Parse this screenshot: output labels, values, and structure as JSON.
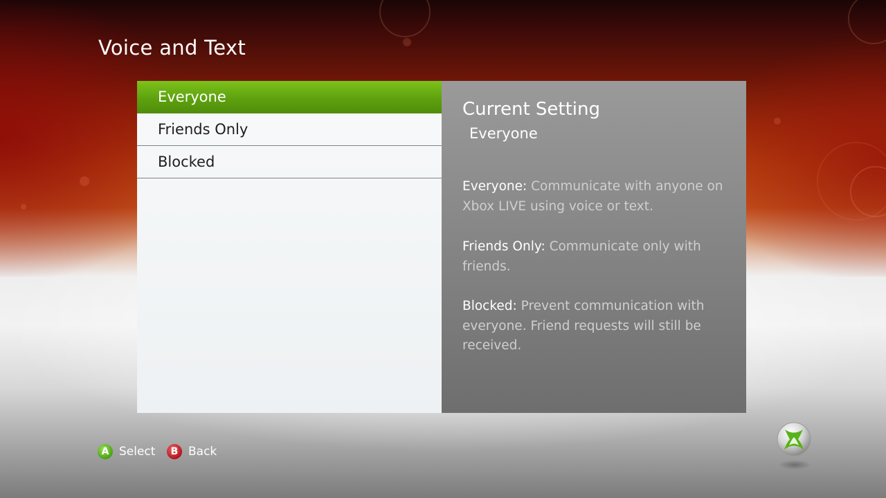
{
  "title": "Voice and Text",
  "options": [
    {
      "label": "Everyone",
      "selected": true
    },
    {
      "label": "Friends Only",
      "selected": false
    },
    {
      "label": "Blocked",
      "selected": false
    }
  ],
  "info": {
    "heading": "Current Setting",
    "current_value": "Everyone",
    "descriptions": [
      {
        "term": "Everyone:",
        "text": "Communicate with anyone on Xbox LIVE using voice or text."
      },
      {
        "term": "Friends Only:",
        "text": "Communicate only with friends."
      },
      {
        "term": "Blocked:",
        "text": "Prevent communication with everyone. Friend requests will still be received."
      }
    ]
  },
  "controls": {
    "a": {
      "key": "A",
      "label": "Select"
    },
    "b": {
      "key": "B",
      "label": "Back"
    }
  },
  "icons": {
    "guide": "xbox-guide-icon"
  },
  "colors": {
    "selected_green": "#5ea10f",
    "a_button": "#4aa112",
    "b_button": "#b5121b",
    "panel_gray": "#878787"
  }
}
